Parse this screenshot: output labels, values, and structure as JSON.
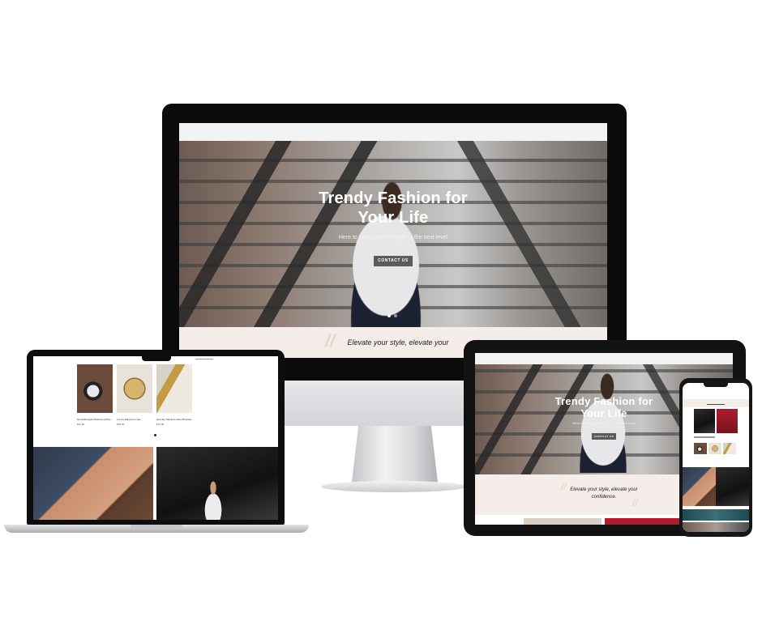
{
  "hero": {
    "title_line1": "Trendy Fashion for",
    "title_line2": "Your Life",
    "subtitle": "Here to bring your life style to the next level",
    "cta_label": "CONTACT US"
  },
  "quote": {
    "text_monitor": "Elevate your style, elevate your",
    "text_tablet_line1": "Elevate your style, elevate your",
    "text_tablet_line2": "confidence."
  },
  "products": [
    {
      "name": "Hematite Agate Balancing Brac...",
      "price": "$12.00"
    },
    {
      "name": "Luxury Diamond Crea...",
      "price": "$45.00"
    },
    {
      "name": "Hip Hop Stainless Steel Bracelet",
      "price": "$12.00"
    }
  ],
  "colors": {
    "quote_band": "#f4ede9",
    "button": "#5b5b5b",
    "accent_red": "#b01c2e"
  }
}
